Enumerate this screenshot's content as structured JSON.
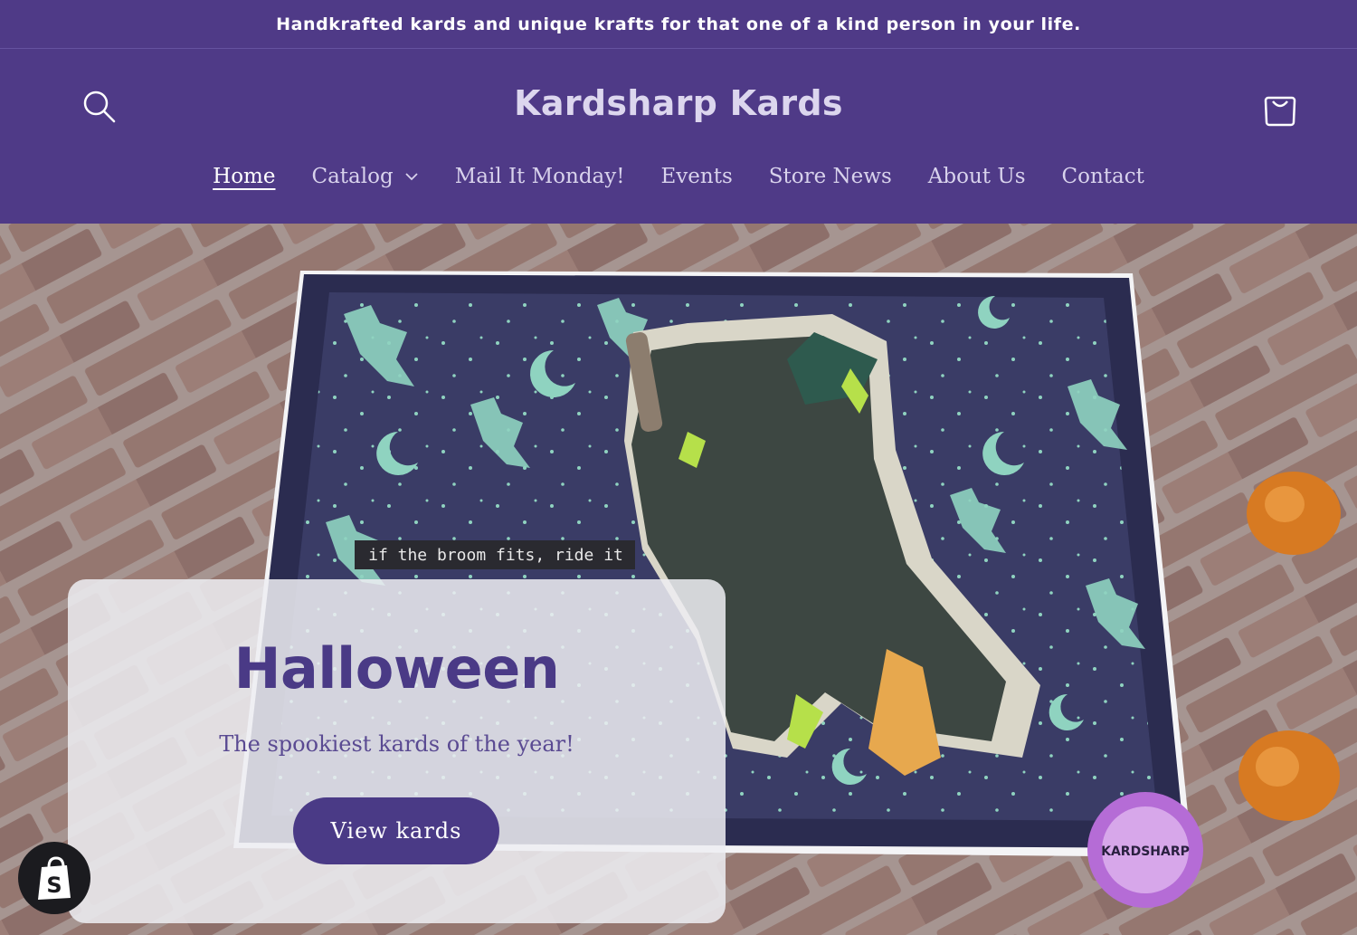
{
  "announcement": {
    "text": "Handkrafted kards and unique krafts for that one of a kind person in your life."
  },
  "header": {
    "logo": "Kardsharp Kards",
    "search_icon": "search-icon",
    "cart_icon": "cart-icon"
  },
  "nav": {
    "items": [
      {
        "label": "Home",
        "active": true
      },
      {
        "label": "Catalog",
        "has_dropdown": true
      },
      {
        "label": "Mail It Monday!"
      },
      {
        "label": "Events"
      },
      {
        "label": "Store News"
      },
      {
        "label": "About Us"
      },
      {
        "label": "Contact"
      }
    ]
  },
  "hero": {
    "heading": "Halloween",
    "subheading": "The spookiest kards of the year!",
    "button_label": "View kards",
    "card_caption": "if the broom fits, ride it",
    "stamp_text": "KARDSHARP"
  },
  "colors": {
    "brand_purple": "#4f3a87",
    "button_purple": "#4a3a86",
    "mint": "#8fd3c0",
    "navy": "#2f3158"
  },
  "shopify_badge": {
    "icon": "shopify-bag-icon",
    "glyph": "S"
  }
}
